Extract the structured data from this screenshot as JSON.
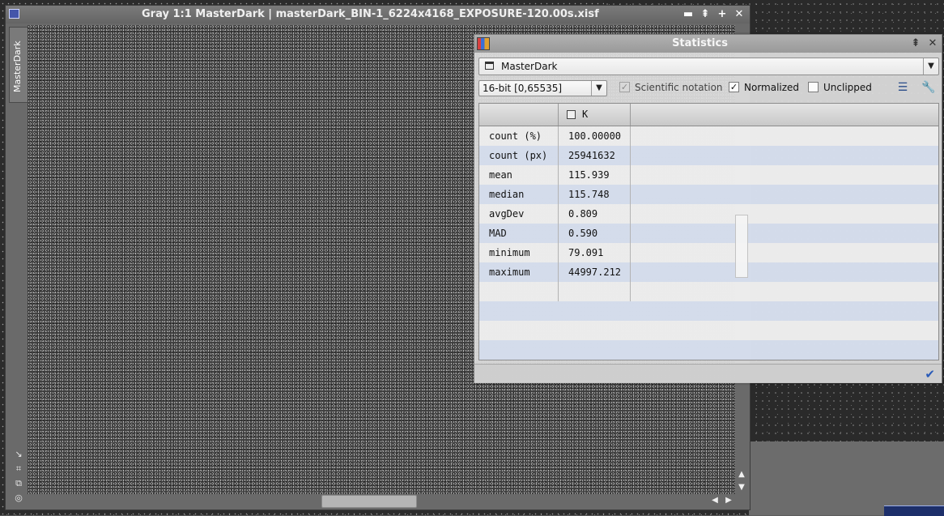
{
  "image_window": {
    "title": "Gray 1:1 MasterDark | masterDark_BIN-1_6224x4168_EXPOSURE-120.00s.xisf",
    "side_tab_label": "MasterDark",
    "controls": {
      "minimize": "▬",
      "shade": "⇞",
      "maximize": "+",
      "close": "✕"
    },
    "side_tools": [
      "↘",
      "⌗",
      "⧉",
      "◎"
    ],
    "scroll_arrows": {
      "up": "▲",
      "down": "▼",
      "left": "◀",
      "right": "▶"
    }
  },
  "statistics": {
    "title": "Statistics",
    "controls": {
      "shade": "⇞",
      "close": "✕"
    },
    "view_select": {
      "value": "MasterDark",
      "arrow": "▼"
    },
    "range_select": {
      "value": "16-bit [0,65535]",
      "arrow": "▼"
    },
    "options": [
      {
        "label": "Scientific notation",
        "checked": true,
        "disabled": true
      },
      {
        "label": "Normalized",
        "checked": true,
        "disabled": false
      },
      {
        "label": "Unclipped",
        "checked": false,
        "disabled": false
      }
    ],
    "checkmark": "✓",
    "tools": {
      "list": "☰",
      "settings": "🔧"
    },
    "table": {
      "column_header": "K",
      "rows": [
        {
          "label": "count (%)",
          "value": "100.00000"
        },
        {
          "label": "count (px)",
          "value": "25941632"
        },
        {
          "label": "mean",
          "value": "115.939"
        },
        {
          "label": "median",
          "value": "115.748"
        },
        {
          "label": "avgDev",
          "value": "0.809"
        },
        {
          "label": "MAD",
          "value": "0.590"
        },
        {
          "label": "minimum",
          "value": "79.091"
        },
        {
          "label": "maximum",
          "value": "44997.212"
        }
      ]
    },
    "apply_icon": "✔"
  },
  "colors": {
    "accent_green": "#2ecc40",
    "row_alt": "#ced8ec",
    "apply_blue": "#2a5bb8"
  }
}
